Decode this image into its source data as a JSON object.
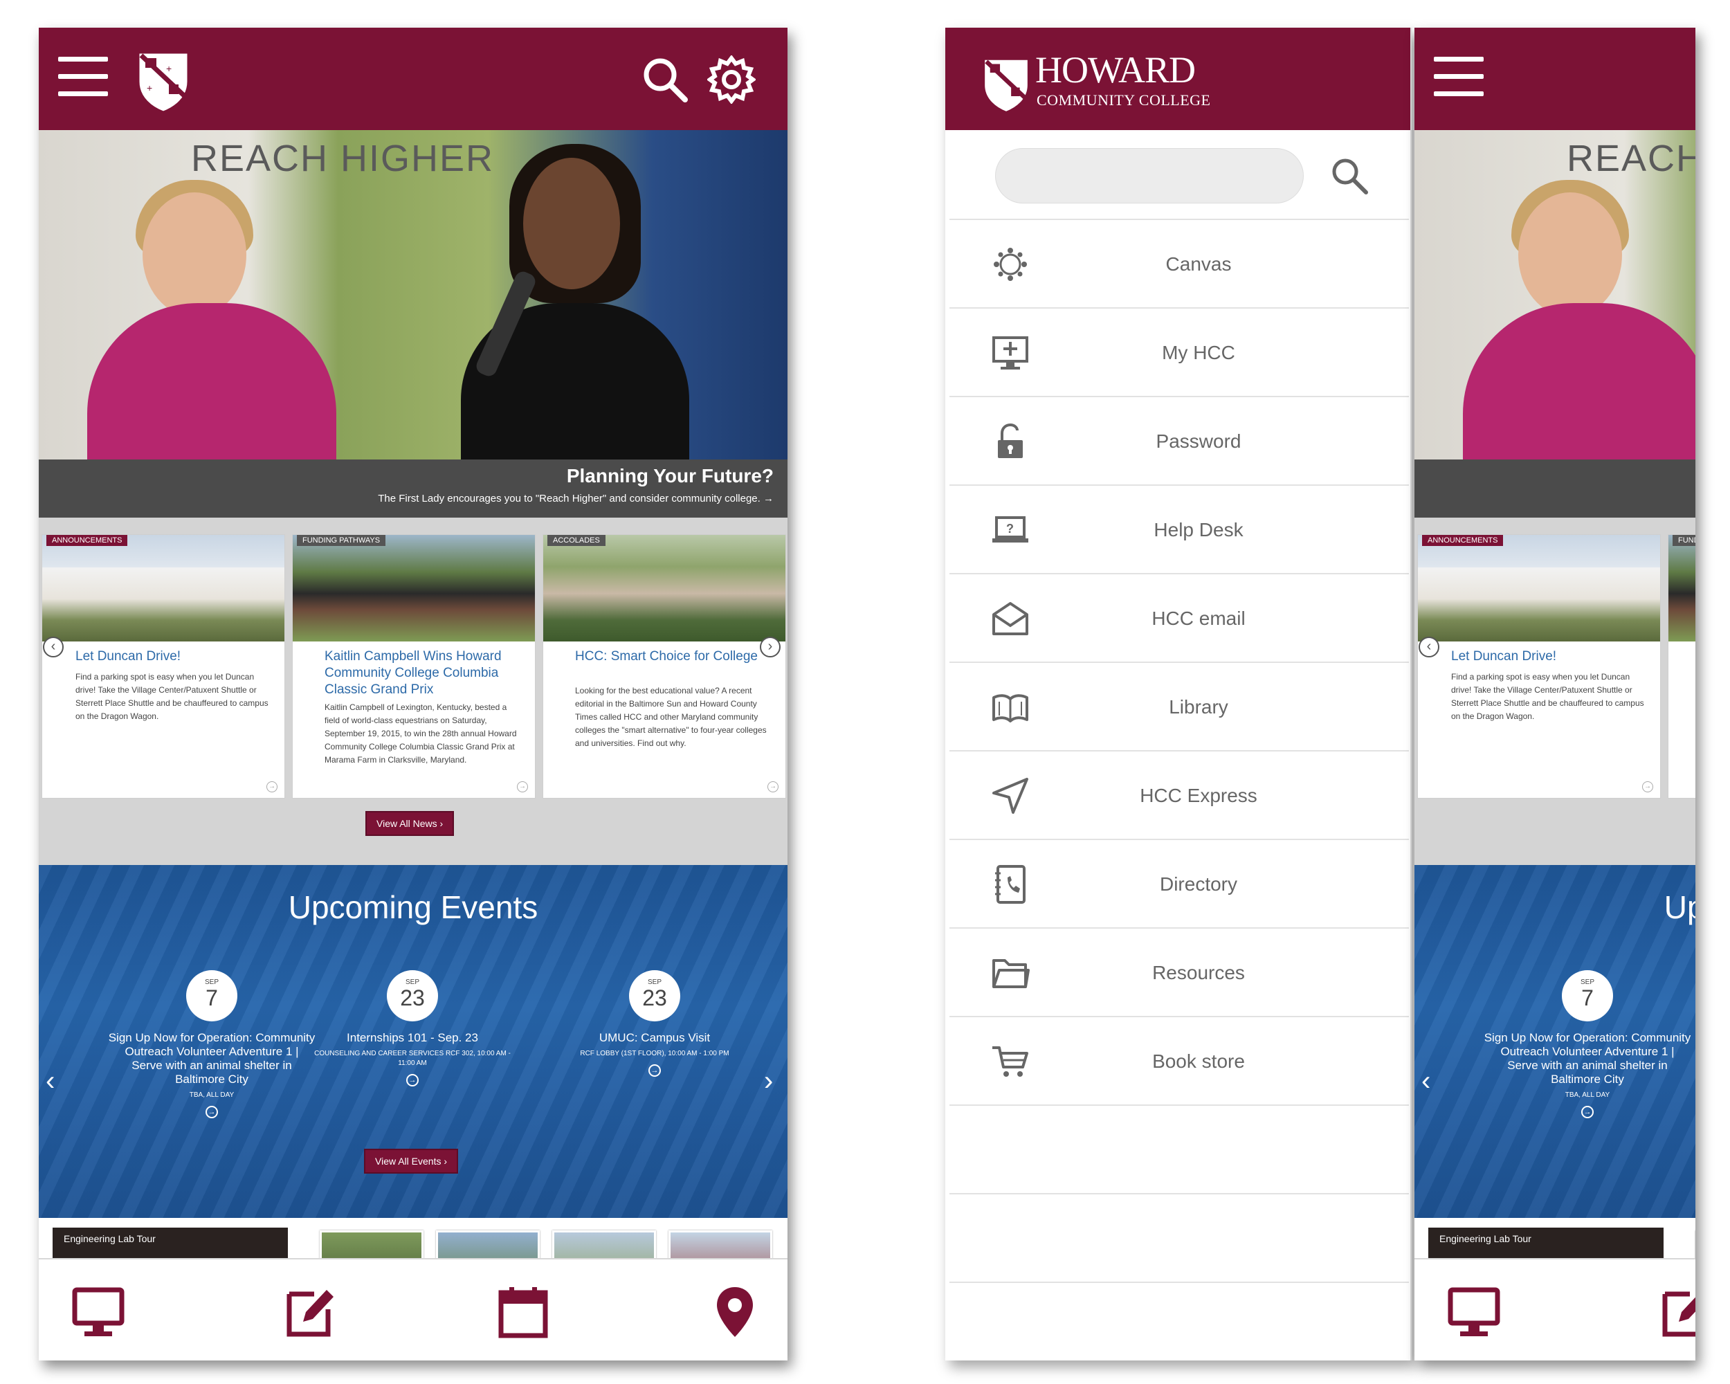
{
  "topbar": {
    "menu_icon": "hamburger-icon",
    "logo": "hcc-crest-logo",
    "search_icon": "search-icon",
    "settings_icon": "gear-icon"
  },
  "hero": {
    "banner_text": "REACH HIGHER",
    "title": "Planning Your Future?",
    "subtitle": "The First Lady encourages you to \"Reach Higher\" and consider community college."
  },
  "news": {
    "cards": [
      {
        "tag": "ANNOUNCEMENTS",
        "headline": "Let Duncan Drive!",
        "body": "Find a parking spot is easy when you let Duncan drive! Take the Village Center/Patuxent Shuttle or Sterrett Place Shuttle and be chauffeured to campus on the Dragon Wagon."
      },
      {
        "tag": "FUNDING PATHWAYS",
        "headline": "Kaitlin Campbell Wins Howard Community College Columbia Classic Grand Prix",
        "body": "Kaitlin Campbell of Lexington, Kentucky, bested a field of world-class equestrians on Saturday, September 19, 2015, to win the 28th annual Howard Community College Columbia Classic Grand Prix at Marama Farm in Clarksville, Maryland."
      },
      {
        "tag": "ACCOLADES",
        "headline": "HCC: Smart Choice for College",
        "body": "Looking for the best educational value? A recent editorial in the Baltimore Sun and Howard County Times called HCC and other Maryland community colleges the \"smart alternative\" to four-year colleges and universities. Find out why."
      }
    ],
    "view_all": "View All News"
  },
  "events": {
    "title": "Upcoming Events",
    "items": [
      {
        "month": "SEP",
        "day": "7",
        "name": "Sign Up Now for Operation: Community Outreach Volunteer Adventure 1 | Serve with an animal shelter in Baltimore City",
        "meta": "TBA, ALL DAY"
      },
      {
        "month": "SEP",
        "day": "23",
        "name": "Internships 101 - Sep. 23",
        "meta": "COUNSELING AND CAREER SERVICES RCF 302, 10:00 AM - 11:00 AM"
      },
      {
        "month": "SEP",
        "day": "23",
        "name": "UMUC: Campus Visit",
        "meta": "RCF LOBBY (1ST FLOOR), 10:00 AM - 1:00 PM"
      }
    ],
    "view_all": "View All Events"
  },
  "videos": {
    "featured_title": "Engineering Lab Tour"
  },
  "bottom_nav": [
    {
      "icon": "monitor-icon"
    },
    {
      "icon": "edit-icon"
    },
    {
      "icon": "calendar-icon"
    },
    {
      "icon": "map-pin-icon"
    }
  ],
  "drawer": {
    "brand_main": "HOWARD",
    "brand_sub": "COMMUNITY COLLEGE",
    "search_placeholder": "",
    "items": [
      {
        "label": "Canvas",
        "icon": "canvas-icon"
      },
      {
        "label": "My HCC",
        "icon": "monitor-plus-icon"
      },
      {
        "label": "Password",
        "icon": "unlock-icon"
      },
      {
        "label": "Help Desk",
        "icon": "laptop-help-icon"
      },
      {
        "label": "HCC email",
        "icon": "envelope-open-icon"
      },
      {
        "label": "Library",
        "icon": "book-icon"
      },
      {
        "label": "HCC Express",
        "icon": "navigation-arrow-icon"
      },
      {
        "label": "Directory",
        "icon": "phone-book-icon"
      },
      {
        "label": "Resources",
        "icon": "folder-icon"
      },
      {
        "label": "Book store",
        "icon": "cart-icon"
      }
    ]
  },
  "colors": {
    "brand_maroon": "#7b1235",
    "events_blue": "#2766ad",
    "link_blue": "#2d6aa8",
    "caption_grey": "#4b4b4b"
  }
}
